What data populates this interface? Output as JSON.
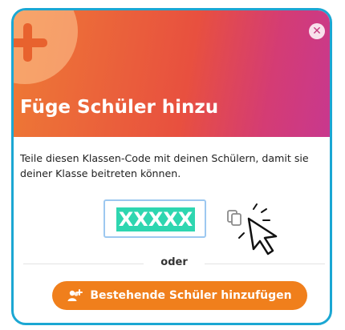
{
  "dialog": {
    "title": "Füge Schüler hinzu",
    "description": "Teile diesen Klassen-Code mit deinen Schülern, damit sie deiner Klasse beitreten können.",
    "close_icon": "close-icon",
    "class_code": "XXXXX",
    "copy_icon": "copy-icon",
    "divider_text": "oder",
    "add_existing_button": "Bestehende Schüler hinzufügen",
    "add_existing_icon": "add-students-icon"
  },
  "colors": {
    "frame_border": "#1ba7d3",
    "header_gradient_start": "#ee7a35",
    "header_gradient_end": "#c8388e",
    "code_highlight": "#2ed6b0",
    "button": "#f07f1c"
  }
}
